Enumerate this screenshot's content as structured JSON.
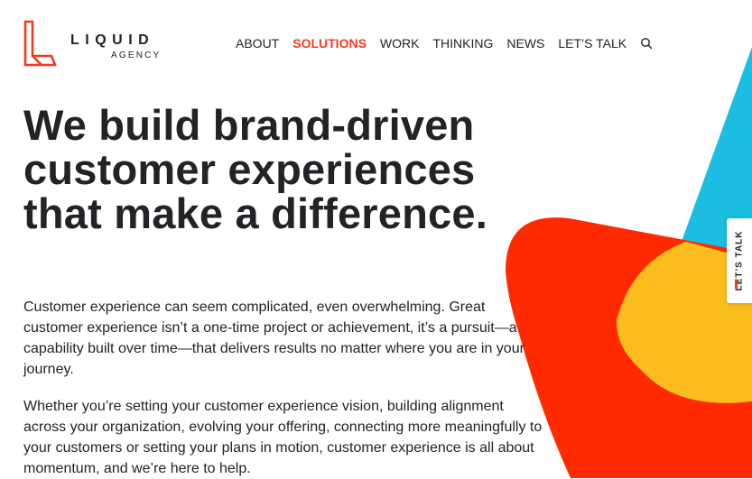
{
  "logo": {
    "name": "LIQUID",
    "sub": "AGENCY",
    "accent": "#ef3b1f"
  },
  "nav": {
    "items": [
      {
        "label": "ABOUT",
        "active": false
      },
      {
        "label": "SOLUTIONS",
        "active": true
      },
      {
        "label": "WORK",
        "active": false
      },
      {
        "label": "THINKING",
        "active": false
      },
      {
        "label": "NEWS",
        "active": false
      },
      {
        "label": "LET’S TALK",
        "active": false
      }
    ],
    "search_icon": "search-icon"
  },
  "hero": {
    "headline_lines": [
      "We build brand-driven",
      "customer experiences",
      "that make a difference."
    ],
    "paragraph_1": "Customer experience can seem complicated, even overwhelming. Great customer experience isn’t a one-time project or achievement, it’s a pursuit—a capability built over time—that delivers results no matter where you are in your journey.",
    "paragraph_2": "Whether you’re setting your customer experience vision, building alignment across your organization, evolving your offering, connecting more meaningfully to your customers or setting your plans in motion, customer experience is all about momentum, and we’re here to help."
  },
  "side_tab": {
    "label": "LET’S TALK"
  },
  "colors": {
    "accent": "#ef3b1f",
    "red": "#ff2a00",
    "yellow": "#fbbd1e",
    "cyan": "#1bbde0",
    "text": "#222326"
  }
}
